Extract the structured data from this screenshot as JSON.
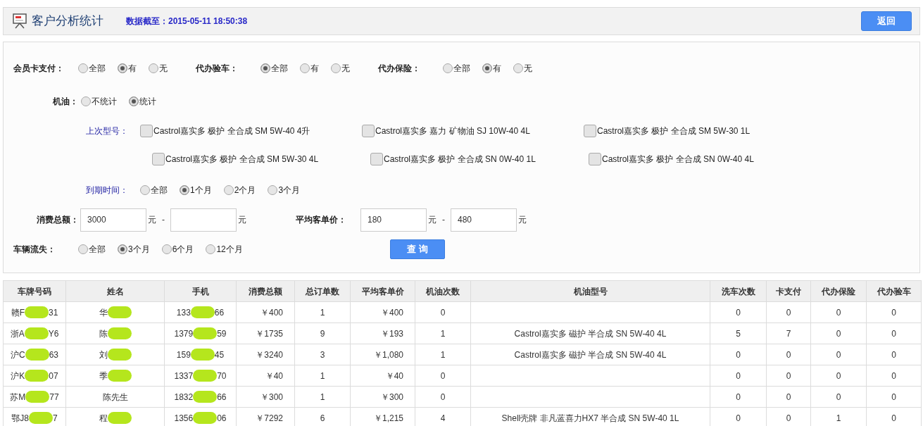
{
  "header": {
    "title": "客户分析统计",
    "data_as_of_label": "数据截至：",
    "data_as_of": "2015-05-11 18:50:38",
    "back_button": "返回"
  },
  "filters": {
    "top_row": [
      {
        "label": "会员卡支付：",
        "options": [
          {
            "label": "全部",
            "selected": false
          },
          {
            "label": "有",
            "selected": true
          },
          {
            "label": "无",
            "selected": false
          }
        ]
      },
      {
        "label": "代办验车：",
        "options": [
          {
            "label": "全部",
            "selected": true
          },
          {
            "label": "有",
            "selected": false
          },
          {
            "label": "无",
            "selected": false
          }
        ]
      },
      {
        "label": "代办保险：",
        "options": [
          {
            "label": "全部",
            "selected": false
          },
          {
            "label": "有",
            "selected": true
          },
          {
            "label": "无",
            "selected": false
          }
        ]
      }
    ],
    "engine_oil": {
      "label": "机油：",
      "options": [
        {
          "label": "不统计",
          "selected": false
        },
        {
          "label": "统计",
          "selected": true
        }
      ]
    },
    "last_model": {
      "label": "上次型号：",
      "rows": [
        [
          {
            "label": "Castrol嘉实多 极护 全合成 SM 5W-40 4升",
            "checked": false
          },
          {
            "label": "Castrol嘉实多 嘉力 矿物油 SJ 10W-40 4L",
            "checked": false
          },
          {
            "label": "Castrol嘉实多 极护 全合成 SM 5W-30 1L",
            "checked": false
          }
        ],
        [
          {
            "label": "Castrol嘉实多 极护 全合成 SM 5W-30 4L",
            "checked": false
          },
          {
            "label": "Castrol嘉实多 极护 全合成 SN 0W-40 1L",
            "checked": false
          },
          {
            "label": "Castrol嘉实多 极护 全合成 SN 0W-40 4L",
            "checked": false
          }
        ]
      ]
    },
    "expiry": {
      "label": "到期时间：",
      "options": [
        {
          "label": "全部",
          "selected": false
        },
        {
          "label": "1个月",
          "selected": true
        },
        {
          "label": "2个月",
          "selected": false
        },
        {
          "label": "3个月",
          "selected": false
        }
      ]
    },
    "total_spend": {
      "label": "消费总额：",
      "from": {
        "value": "3000",
        "unit": "元"
      },
      "separator": "-",
      "to": {
        "unit": "元"
      }
    },
    "average_price": {
      "label": "平均客单价：",
      "from": {
        "value": "180",
        "unit": "元"
      },
      "separator": "-",
      "to": {
        "value": "480",
        "unit": "元"
      }
    },
    "vehicle_churn": {
      "label": "车辆流失：",
      "options": [
        {
          "label": "全部",
          "selected": false
        },
        {
          "label": "3个月",
          "selected": true
        },
        {
          "label": "6个月",
          "selected": false
        },
        {
          "label": "12个月",
          "selected": false
        }
      ]
    },
    "query_button": "查 询"
  },
  "table": {
    "columns": [
      "车牌号码",
      "姓名",
      "手机",
      "消费总额",
      "总订单数",
      "平均客单价",
      "机油次数",
      "机油型号",
      "洗车次数",
      "卡支付",
      "代办保险",
      "代办验车"
    ],
    "rows": [
      [
        {
          "before": "赣F",
          "after": "31"
        },
        {
          "before": "华"
        },
        {
          "before": "133",
          "after": "66"
        },
        "￥400",
        "1",
        "￥400",
        "0",
        "",
        "0",
        "0",
        "0",
        "0"
      ],
      [
        {
          "before": "浙A",
          "after": "Y6"
        },
        {
          "before": "陈"
        },
        {
          "before": "1379",
          "after": "59"
        },
        "￥1735",
        "9",
        "￥193",
        "1",
        "Castrol嘉实多 磁护 半合成 SN 5W-40 4L",
        "5",
        "7",
        "0",
        "0"
      ],
      [
        {
          "before": "沪C",
          "after": "63"
        },
        {
          "before": "刘"
        },
        {
          "before": "159",
          "after": "45"
        },
        "￥3240",
        "3",
        "￥1,080",
        "1",
        "Castrol嘉实多 磁护 半合成 SN 5W-40 4L",
        "0",
        "0",
        "0",
        "0"
      ],
      [
        {
          "before": "沪K",
          "after": "07"
        },
        {
          "before": "季"
        },
        {
          "before": "1337",
          "after": "70"
        },
        "￥40",
        "1",
        "￥40",
        "0",
        "",
        "0",
        "0",
        "0",
        "0"
      ],
      [
        {
          "before": "苏M",
          "after": "77"
        },
        "陈先生",
        {
          "before": "1832",
          "after": "66"
        },
        "￥300",
        "1",
        "￥300",
        "0",
        "",
        "0",
        "0",
        "0",
        "0"
      ],
      [
        {
          "before": "鄂J8",
          "after": "7"
        },
        {
          "before": "程"
        },
        {
          "before": "1356",
          "after": "06"
        },
        "￥7292",
        "6",
        "￥1,215",
        "4",
        "Shell壳牌 非凡蓝喜力HX7 半合成 SN 5W-40 1L",
        "0",
        "0",
        "1",
        "0"
      ]
    ]
  }
}
